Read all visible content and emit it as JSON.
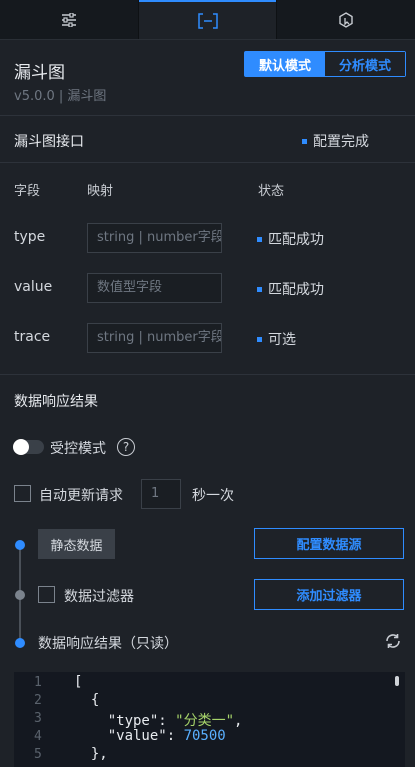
{
  "tabs": [
    {
      "icon": "sliders-icon"
    },
    {
      "icon": "bracket-mapping-icon"
    },
    {
      "icon": "interaction-icon"
    }
  ],
  "header": {
    "title": "漏斗图",
    "version": "v5.0.0 | 漏斗图",
    "mode_default": "默认模式",
    "mode_analysis": "分析模式"
  },
  "interface": {
    "title": "漏斗图接口",
    "status": "配置完成"
  },
  "fields": {
    "col_field": "字段",
    "col_mapping": "映射",
    "col_status": "状态",
    "rows": [
      {
        "name": "type",
        "placeholder": "string | number字段",
        "status": "匹配成功"
      },
      {
        "name": "value",
        "placeholder": "数值型字段",
        "status": "匹配成功"
      },
      {
        "name": "trace",
        "placeholder": "string | number字段",
        "status": "可选"
      }
    ]
  },
  "response": {
    "title": "数据响应结果",
    "controlled_label": "受控模式",
    "auto_update_label": "自动更新请求",
    "auto_update_value": "1",
    "auto_update_unit": "秒一次",
    "static_data": "静态数据",
    "config_source": "配置数据源",
    "filter_label": "数据过滤器",
    "add_filter": "添加过滤器",
    "result_label": "数据响应结果（只读）"
  },
  "code": {
    "line_numbers": [
      "1",
      "2",
      "3",
      "4",
      "5"
    ],
    "line1": "[",
    "line2": "  {",
    "line3_key": "    \"type\"",
    "line3_colon": ": ",
    "line3_val": "\"分类一\"",
    "line3_comma": ",",
    "line4_key": "    \"value\"",
    "line4_colon": ": ",
    "line4_val": "70500",
    "line5": "  },"
  },
  "colors": {
    "accent": "#2f8cff",
    "background": "#1e2228",
    "tab_bar": "#15191e"
  }
}
